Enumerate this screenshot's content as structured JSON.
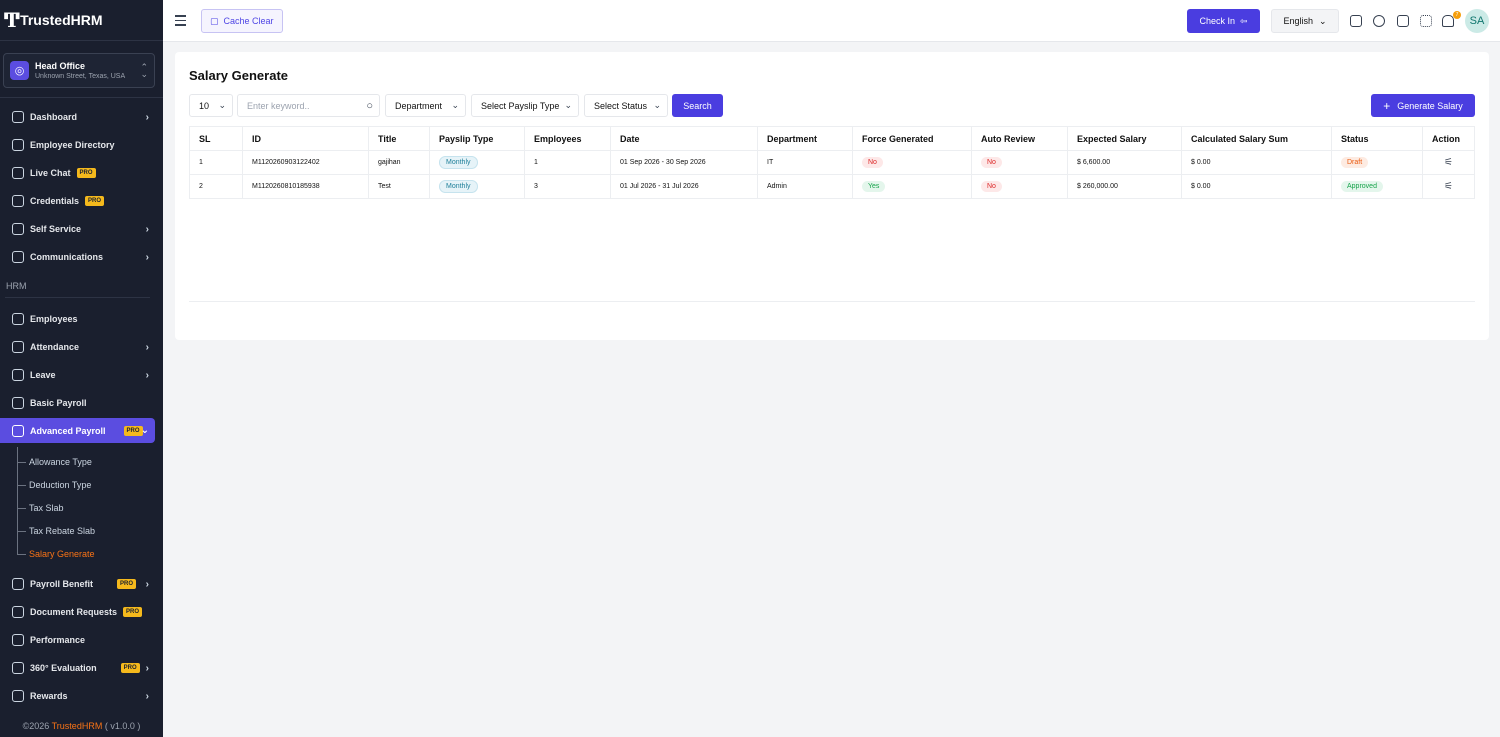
{
  "brand": {
    "name": "TrustedHRM"
  },
  "branch": {
    "name": "Head Office",
    "address": "Unknown Street, Texas, USA"
  },
  "sidebar": {
    "items": [
      {
        "label": "Dashboard",
        "chevron": true
      },
      {
        "label": "Employee Directory"
      },
      {
        "label": "Live Chat",
        "badge": "PRO"
      },
      {
        "label": "Credentials",
        "badge": "PRO"
      },
      {
        "label": "Self Service",
        "chevron": true
      },
      {
        "label": "Communications",
        "chevron": true
      }
    ],
    "section": "HRM",
    "hrm_items": [
      {
        "label": "Employees"
      },
      {
        "label": "Attendance",
        "chevron": true
      },
      {
        "label": "Leave",
        "chevron": true
      },
      {
        "label": "Basic Payroll"
      },
      {
        "label": "Advanced Payroll",
        "badge": "PRO",
        "active": true
      }
    ],
    "sub_items": [
      "Allowance Type",
      "Deduction Type",
      "Tax Slab",
      "Tax Rebate Slab",
      "Salary Generate"
    ],
    "more_items": [
      {
        "label": "Payroll Benefit",
        "badge": "PRO",
        "chevron": true
      },
      {
        "label": "Document Requests",
        "badge": "PRO"
      },
      {
        "label": "Performance"
      },
      {
        "label": "360° Evaluation",
        "badge": "PRO",
        "chevron": true
      },
      {
        "label": "Rewards",
        "chevron": true
      }
    ],
    "footer": {
      "prefix": "©2026 ",
      "brand": "TrustedHRM",
      "suffix": " ( v1.0.0 )"
    }
  },
  "topbar": {
    "cache_label": "Cache Clear",
    "checkin_label": "Check In",
    "language": "English",
    "notification_count": "7",
    "avatar_initials": "SA"
  },
  "page": {
    "title": "Salary Generate",
    "per_page": "10",
    "search_placeholder": "Enter keyword..",
    "department_select": "Department",
    "payslip_select": "Select Payslip Type",
    "status_select": "Select Status",
    "search_button": "Search",
    "generate_button": "Generate Salary"
  },
  "table": {
    "headers": [
      "SL",
      "ID",
      "Title",
      "Payslip Type",
      "Employees",
      "Date",
      "Department",
      "Force Generated",
      "Auto Review",
      "Expected Salary",
      "Calculated Salary Sum",
      "Status",
      "Action"
    ],
    "rows": [
      {
        "sl": "1",
        "id": "M1120260903122402",
        "title": "gajihan",
        "payslip": "Monthly",
        "employees": "1",
        "date": "01 Sep 2026 - 30 Sep 2026",
        "department": "IT",
        "force": "No",
        "auto": "No",
        "expected": "$ 6,600.00",
        "calculated": "$ 0.00",
        "status": "Draft"
      },
      {
        "sl": "2",
        "id": "M1120260810185938",
        "title": "Test",
        "payslip": "Monthly",
        "employees": "3",
        "date": "01 Jul 2026 - 31 Jul 2026",
        "department": "Admin",
        "force": "Yes",
        "auto": "No",
        "expected": "$ 260,000.00",
        "calculated": "$ 0.00",
        "status": "Approved"
      }
    ]
  }
}
